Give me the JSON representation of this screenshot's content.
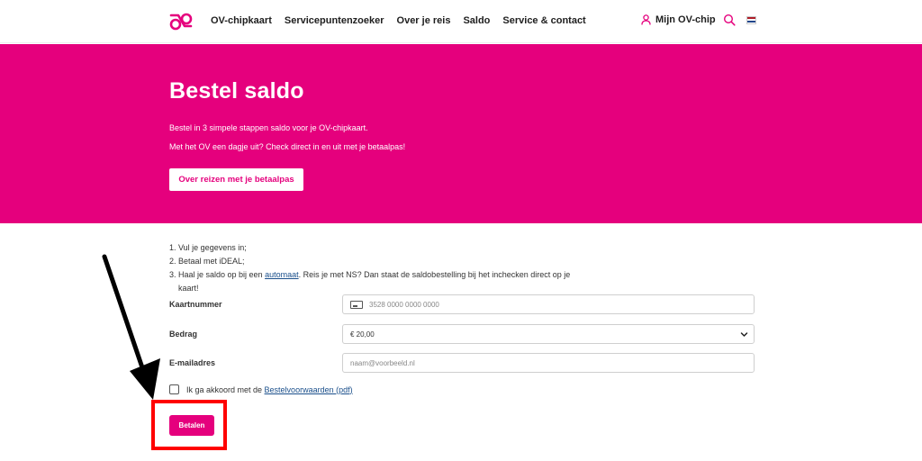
{
  "header": {
    "nav": [
      "OV-chipkaart",
      "Servicepuntenzoeker",
      "Over je reis",
      "Saldo",
      "Service & contact"
    ],
    "account_label": "Mijn OV-chip",
    "icons": {
      "logo": "ov-chip-logo",
      "account": "person-icon",
      "search": "search-icon",
      "language": "dutch-flag-icon"
    },
    "brand_color": "#e5007d"
  },
  "hero": {
    "title": "Bestel saldo",
    "line1": "Bestel in 3 simpele stappen saldo voor je OV-chipkaart.",
    "line2": "Met het OV een dagje uit? Check direct in en uit met je betaalpas!",
    "button_label": "Over reizen met je betaalpas"
  },
  "steps": {
    "step1": "Vul je gegevens in;",
    "step2": "Betaal met iDEAL;",
    "step3_before": "Haal je saldo op bij een ",
    "step3_link": "automaat",
    "step3_after": ". Reis je met NS? Dan staat de saldobestelling bij het inchecken direct op je",
    "step3_cont": "kaart!"
  },
  "form": {
    "kaartnummer_label": "Kaartnummer",
    "kaartnummer_placeholder": "3528 0000 0000 0000",
    "bedrag_label": "Bedrag",
    "bedrag_value": "€ 20,00",
    "email_label": "E-mailadres",
    "email_placeholder": "naam@voorbeeld.nl",
    "agree_before": "Ik ga akkoord met de ",
    "agree_link": "Bestelvoorwaarden (pdf)",
    "pay_label": "Betalen"
  }
}
